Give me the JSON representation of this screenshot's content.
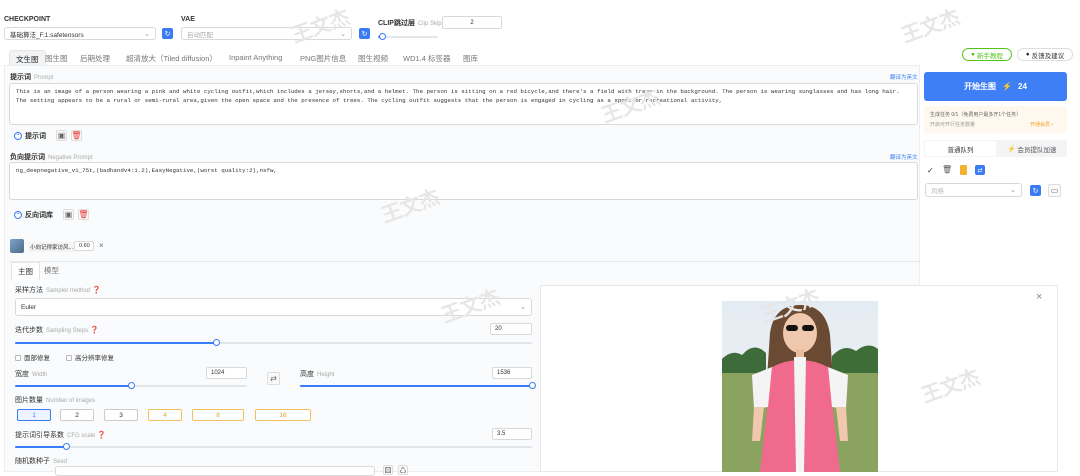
{
  "header": {
    "checkpoint_label": "CHECKPOINT",
    "checkpoint_value": "基础算法_F.1.safetensors",
    "vae_label": "VAE",
    "vae_value": "自动匹配",
    "clip_label": "CLIP跳过层",
    "clip_sub": "Clip Skip",
    "clip_value": "2",
    "clip_fraction": 0.08
  },
  "tabs": [
    "文生图",
    "图生图",
    "后期处理",
    "超清放大（Tiled diffusion）",
    "Inpaint Anything",
    "PNG图片信息",
    "图生视频",
    "WD1.4 标签器",
    "图库"
  ],
  "top_right": {
    "tutorial": "新手教程",
    "feedback": "反馈及建议"
  },
  "prompt": {
    "label": "提示词",
    "sub": "Prompt",
    "translate": "翻译为英文",
    "text": "This is an image of a person wearing a pink and white cycling outfit,which includes a jersey,shorts,and a helmet. The person is sitting on a red bicycle,and there's a field with trees in the background. The person is wearing sunglasses and has long hair. The setting appears to be a rural or semi-rural area,given the open space and the presence of trees. The cycling outfit suggests that the person is engaged in cycling as a sport or recreational activity,",
    "tools_label": "提示词"
  },
  "negative": {
    "label": "负向提示词",
    "sub": "Negative Prompt",
    "translate": "翻译为英文",
    "text": "ng_deepnegative_v1_75t,(badhandv4:1.2),EasyNegative,(worst quality:2),nsfw,",
    "tools_label": "反向词库"
  },
  "lora": {
    "name": "小向记得家访风...",
    "weight": "0.60"
  },
  "subtabs": [
    "主图",
    "模型"
  ],
  "sampler": {
    "label": "采样方法",
    "sub": "Sampler method",
    "value": "Euler"
  },
  "steps": {
    "label": "迭代步数",
    "sub": "Sampling Steps",
    "value": "20",
    "fraction": 0.39
  },
  "options": [
    "面部修复",
    "高分辨率修复"
  ],
  "width": {
    "label": "宽度",
    "sub": "Width",
    "value": "1024",
    "fraction": 0.5
  },
  "height": {
    "label": "高度",
    "sub": "Height",
    "value": "1536",
    "fraction": 1.0
  },
  "batch": {
    "label": "图片数量",
    "sub": "Number of images",
    "options": [
      "1",
      "2",
      "3",
      "4",
      "8",
      "16"
    ],
    "selected": "1"
  },
  "cfg": {
    "label": "提示词引导系数",
    "sub": "CFG scale",
    "value": "3.5",
    "fraction": 0.1
  },
  "seed": {
    "label": "随机数种子",
    "sub": "Seed"
  },
  "generate": {
    "label": "开始生图",
    "cost": "24"
  },
  "queue": {
    "status": "生成任务 0/1（免费用户最多开1个任务）",
    "limit": "开启可开行任务数量",
    "vip_link": "开通会员 ›",
    "normal": "普通队列",
    "vip": "会员提队加速"
  },
  "style": {
    "placeholder": "风格"
  },
  "watermark": "王文杰",
  "colors": {
    "accent": "#3b7cf6",
    "generate": "#3f7ff5",
    "tutorial": "#52c41a"
  }
}
